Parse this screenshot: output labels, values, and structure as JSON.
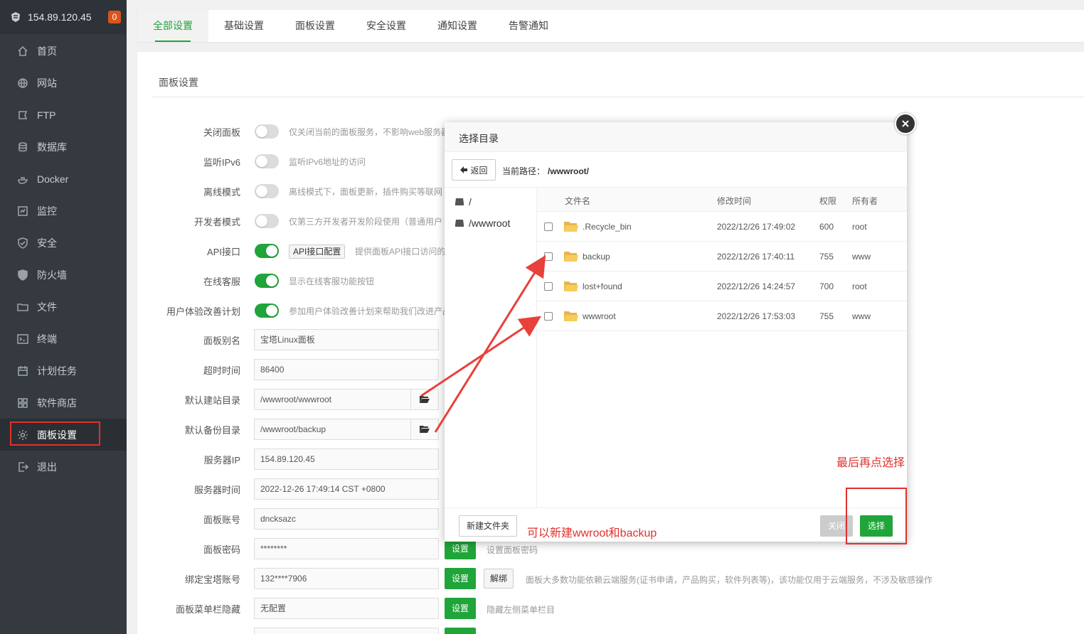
{
  "sidebar": {
    "ip": "154.89.120.45",
    "badge": "0",
    "items": [
      {
        "label": "首页",
        "icon": "home-icon"
      },
      {
        "label": "网站",
        "icon": "globe-icon"
      },
      {
        "label": "FTP",
        "icon": "ftp-icon"
      },
      {
        "label": "数据库",
        "icon": "database-icon"
      },
      {
        "label": "Docker",
        "icon": "docker-icon"
      },
      {
        "label": "监控",
        "icon": "monitor-icon"
      },
      {
        "label": "安全",
        "icon": "shield-icon"
      },
      {
        "label": "防火墙",
        "icon": "firewall-icon"
      },
      {
        "label": "文件",
        "icon": "folder-icon"
      },
      {
        "label": "终端",
        "icon": "terminal-icon"
      },
      {
        "label": "计划任务",
        "icon": "calendar-icon"
      },
      {
        "label": "软件商店",
        "icon": "apps-icon"
      },
      {
        "label": "面板设置",
        "icon": "gear-icon"
      },
      {
        "label": "退出",
        "icon": "logout-icon"
      }
    ]
  },
  "tabs": [
    "全部设置",
    "基础设置",
    "面板设置",
    "安全设置",
    "通知设置",
    "告警通知"
  ],
  "section_title": "面板设置",
  "settings": {
    "close_panel": {
      "label": "关闭面板",
      "hint": "仅关闭当前的面板服务，不影响web服务器"
    },
    "ipv6": {
      "label": "监听IPv6",
      "hint": "监听IPv6地址的访问"
    },
    "offline": {
      "label": "离线模式",
      "hint": "离线模式下，面板更新，插件购买等联网"
    },
    "dev": {
      "label": "开发者模式",
      "hint": "仅第三方开发者开发阶段使用（普通用户"
    },
    "api": {
      "label": "API接口",
      "button": "API接口配置",
      "hint": "提供面板API接口访问的"
    },
    "service": {
      "label": "在线客服",
      "hint": "显示在线客服功能按钮"
    },
    "ux": {
      "label": "用户体验改善计划",
      "hint": "参加用户体验改善计划来帮助我们改进产品"
    },
    "alias": {
      "label": "面板别名",
      "value": "宝塔Linux面板"
    },
    "timeout": {
      "label": "超时时间",
      "value": "86400"
    },
    "site_dir": {
      "label": "默认建站目录",
      "value": "/wwwroot/wwwroot"
    },
    "backup_dir": {
      "label": "默认备份目录",
      "value": "/wwwroot/backup"
    },
    "server_ip": {
      "label": "服务器IP",
      "value": "154.89.120.45"
    },
    "server_time": {
      "label": "服务器时间",
      "value": "2022-12-26 17:49:14 CST +0800"
    },
    "account": {
      "label": "面板账号",
      "value": "dncksazc"
    },
    "password": {
      "label": "面板密码",
      "value": "********",
      "button": "设置",
      "hint": "设置面板密码"
    },
    "bind": {
      "label": "绑定宝塔账号",
      "value": "132****7906",
      "button": "设置",
      "button2": "解绑",
      "hint": "面板大多数功能依赖云端服务(证书申请，产品购买，软件列表等)，该功能仅用于云端服务，不涉及敏感操作"
    },
    "menu_hide": {
      "label": "面板菜单栏隐藏",
      "value": "无配置",
      "button": "设置",
      "hint": "隐藏左侧菜单栏目"
    }
  },
  "modal": {
    "title": "选择目录",
    "back": "返回",
    "path_label": "当前路径：",
    "path_value": "/wwwroot/",
    "tree": [
      "/",
      "/wwwroot"
    ],
    "columns": [
      "文件名",
      "修改时间",
      "权限",
      "所有者"
    ],
    "rows": [
      {
        "name": ".Recycle_bin",
        "time": "2022/12/26 17:49:02",
        "perm": "600",
        "owner": "root"
      },
      {
        "name": "backup",
        "time": "2022/12/26 17:40:11",
        "perm": "755",
        "owner": "www"
      },
      {
        "name": "lost+found",
        "time": "2022/12/26 14:24:57",
        "perm": "700",
        "owner": "root"
      },
      {
        "name": "wwwroot",
        "time": "2022/12/26 17:53:03",
        "perm": "755",
        "owner": "www"
      }
    ],
    "new_folder": "新建文件夹",
    "close": "关闭",
    "select": "选择"
  },
  "annotations": {
    "tip_new": "可以新建wwroot和backup",
    "tip_select": "最后再点选择"
  },
  "colors": {
    "accent": "#20a53a",
    "sidebar": "#343a40",
    "annotation": "#e0312d"
  }
}
